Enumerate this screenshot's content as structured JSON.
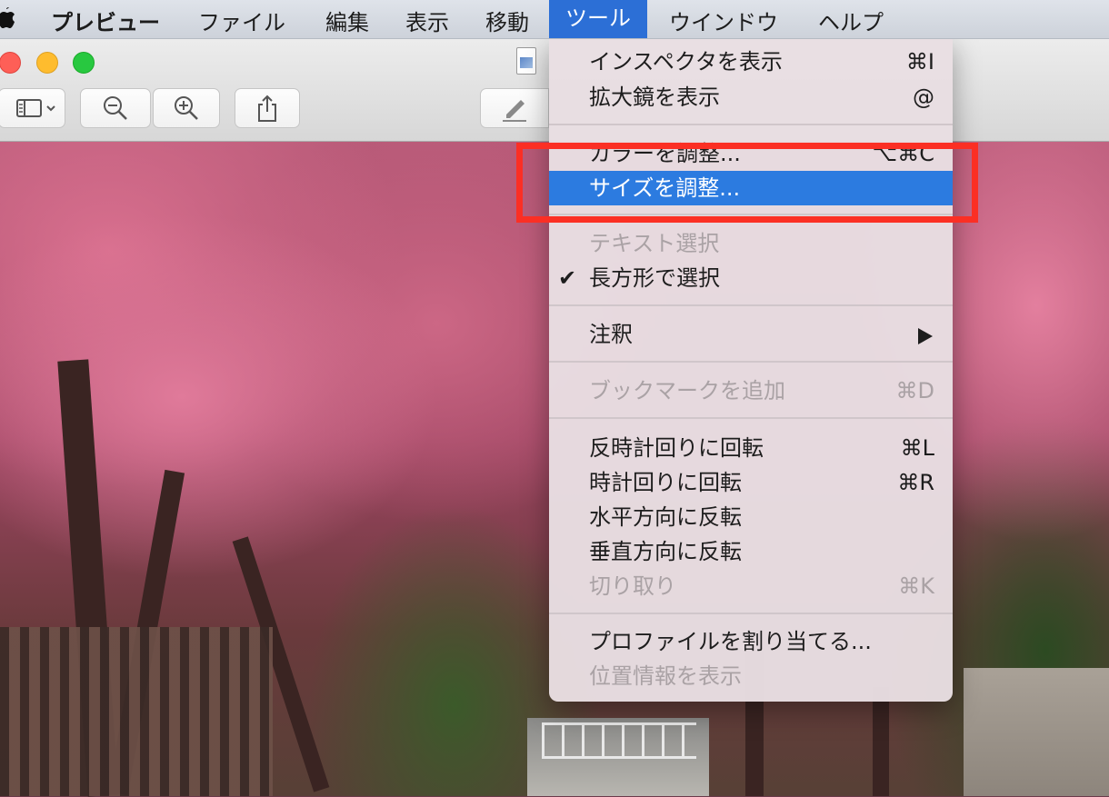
{
  "menubar": {
    "app_name": "プレビュー",
    "items": [
      "ファイル",
      "編集",
      "表示",
      "移動",
      "ツール",
      "ウインドウ",
      "ヘルプ"
    ],
    "active_index": 4
  },
  "toolbar": {
    "icons": [
      "sidebar-icon",
      "chevron-down-icon",
      "zoom-out-icon",
      "zoom-in-icon",
      "share-icon",
      "markup-pen-icon"
    ]
  },
  "tools_menu": {
    "items": [
      {
        "label": "インスペクタを表示",
        "shortcut": "⌘I",
        "enabled": true
      },
      {
        "label": "拡大鏡を表示",
        "shortcut": "@",
        "enabled": true
      },
      {
        "label": "カラーを調整...",
        "shortcut": "⌥⌘C",
        "enabled": true
      },
      {
        "label": "サイズを調整...",
        "shortcut": "",
        "enabled": true,
        "highlighted": true
      },
      {
        "label": "テキスト選択",
        "shortcut": "",
        "enabled": false
      },
      {
        "label": "長方形で選択",
        "shortcut": "",
        "enabled": true,
        "checked": true,
        "check_mark": "✔"
      },
      {
        "label": "注釈",
        "shortcut": "",
        "enabled": true,
        "submenu": true
      },
      {
        "label": "ブックマークを追加",
        "shortcut": "⌘D",
        "enabled": false
      },
      {
        "label": "反時計回りに回転",
        "shortcut": "⌘L",
        "enabled": true
      },
      {
        "label": "時計回りに回転",
        "shortcut": "⌘R",
        "enabled": true
      },
      {
        "label": "水平方向に反転",
        "shortcut": "",
        "enabled": true
      },
      {
        "label": "垂直方向に反転",
        "shortcut": "",
        "enabled": true
      },
      {
        "label": "切り取り",
        "shortcut": "⌘K",
        "enabled": false
      },
      {
        "label": "プロファイルを割り当てる...",
        "shortcut": "",
        "enabled": true
      },
      {
        "label": "位置情報を表示",
        "shortcut": "",
        "enabled": false
      }
    ]
  },
  "colors": {
    "highlight": "#2c7be0",
    "annotation_box": "#fb2f24"
  }
}
